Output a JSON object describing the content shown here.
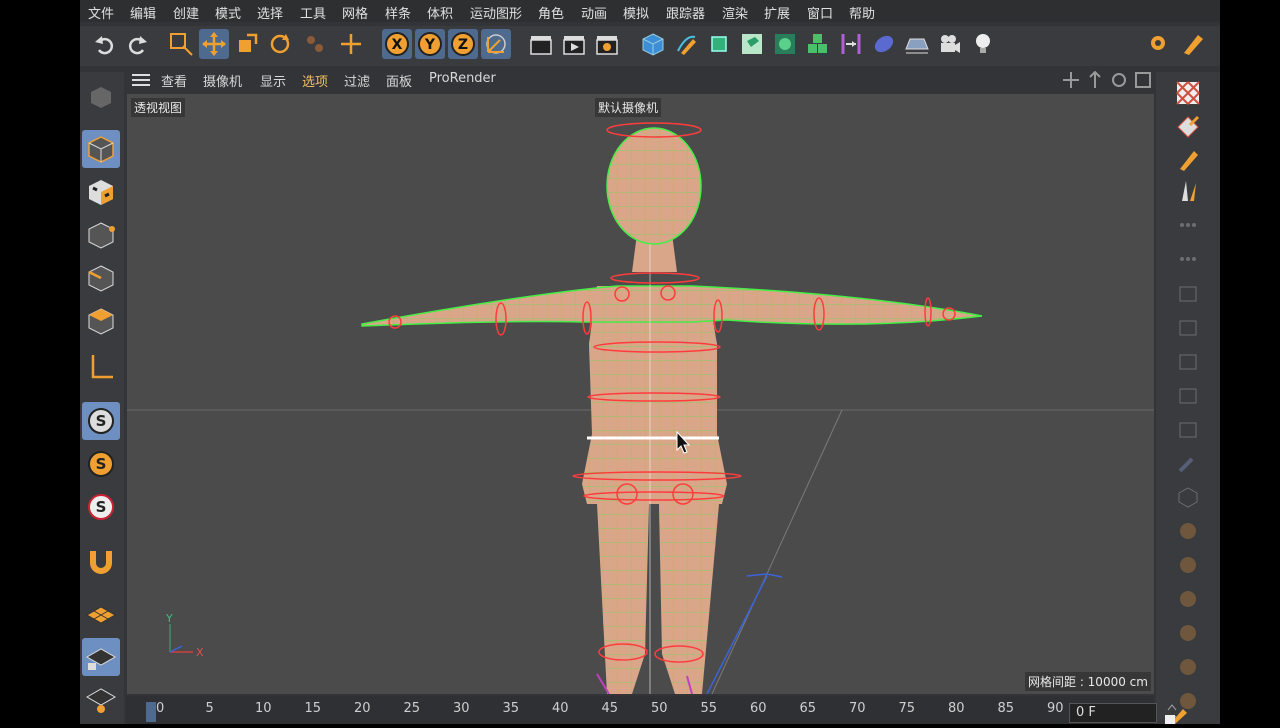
{
  "menu": [
    "文件",
    "编辑",
    "创建",
    "模式",
    "选择",
    "工具",
    "网格",
    "样条",
    "体积",
    "运动图形",
    "角色",
    "动画",
    "模拟",
    "跟踪器",
    "渲染",
    "扩展",
    "窗口",
    "帮助"
  ],
  "toolbar": {
    "undo_icon": "undo-icon",
    "redo_icon": "redo-icon",
    "axis_labels": [
      "X",
      "Y",
      "Z"
    ]
  },
  "viewport_menu": [
    "查看",
    "摄像机",
    "显示",
    "选项",
    "过滤",
    "面板",
    "ProRender"
  ],
  "viewport": {
    "view_name": "透视视图",
    "camera_name": "默认摄像机",
    "grid_spacing": "网格间距 : 10000 cm",
    "axis": {
      "y": "Y",
      "x": "X"
    }
  },
  "left_palette": {
    "snap_labels": [
      "S",
      "S",
      "S"
    ]
  },
  "timeline": {
    "ticks": [
      "0",
      "5",
      "10",
      "15",
      "20",
      "25",
      "30",
      "35",
      "40",
      "45",
      "50",
      "55",
      "60",
      "65",
      "70",
      "75",
      "80",
      "85",
      "90"
    ],
    "current_frame": "0 F"
  },
  "colors": {
    "accent_orange": "#f0a030",
    "select_blue": "#4e6a8f",
    "wire_green": "#44ee44",
    "skin": "#d9a68a",
    "red_handle": "#ff3c3c"
  }
}
